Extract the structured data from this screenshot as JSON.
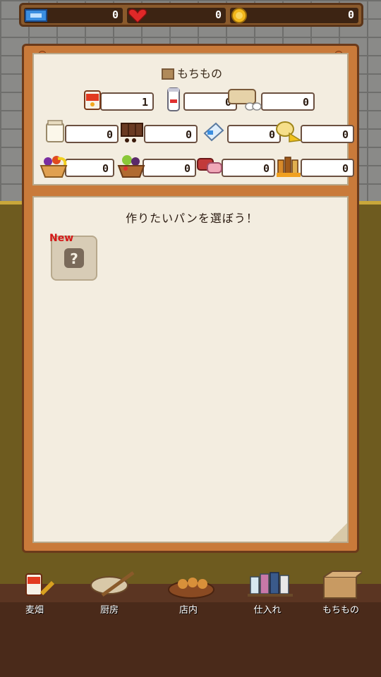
{
  "status": {
    "tickets": "0",
    "hearts": "0",
    "coins": "0"
  },
  "inventory": {
    "title": "もちもの",
    "items": [
      {
        "icon": "flour-bag-icon",
        "count": "1"
      },
      {
        "icon": "milk-bottle-icon",
        "count": "0"
      },
      {
        "icon": "eggs-icon",
        "count": "0"
      },
      {
        "icon": "sugar-jar-icon",
        "count": "0"
      },
      {
        "icon": "chocolate-icon",
        "count": "0"
      },
      {
        "icon": "salt-icon",
        "count": "0"
      },
      {
        "icon": "cheese-icon",
        "count": "0"
      },
      {
        "icon": "fruit-basket-icon",
        "count": "0"
      },
      {
        "icon": "vegetable-basket-icon",
        "count": "0"
      },
      {
        "icon": "meat-icon",
        "count": "0"
      },
      {
        "icon": "spices-icon",
        "count": "0"
      }
    ]
  },
  "recipes": {
    "title": "作りたいパンを選ぼう！",
    "new_badge": "New",
    "slot_symbol": "?"
  },
  "nav": {
    "wheat_field": "麦畑",
    "kitchen": "厨房",
    "store": "店内",
    "stock": "仕入れ",
    "inventory": "もちもの"
  }
}
